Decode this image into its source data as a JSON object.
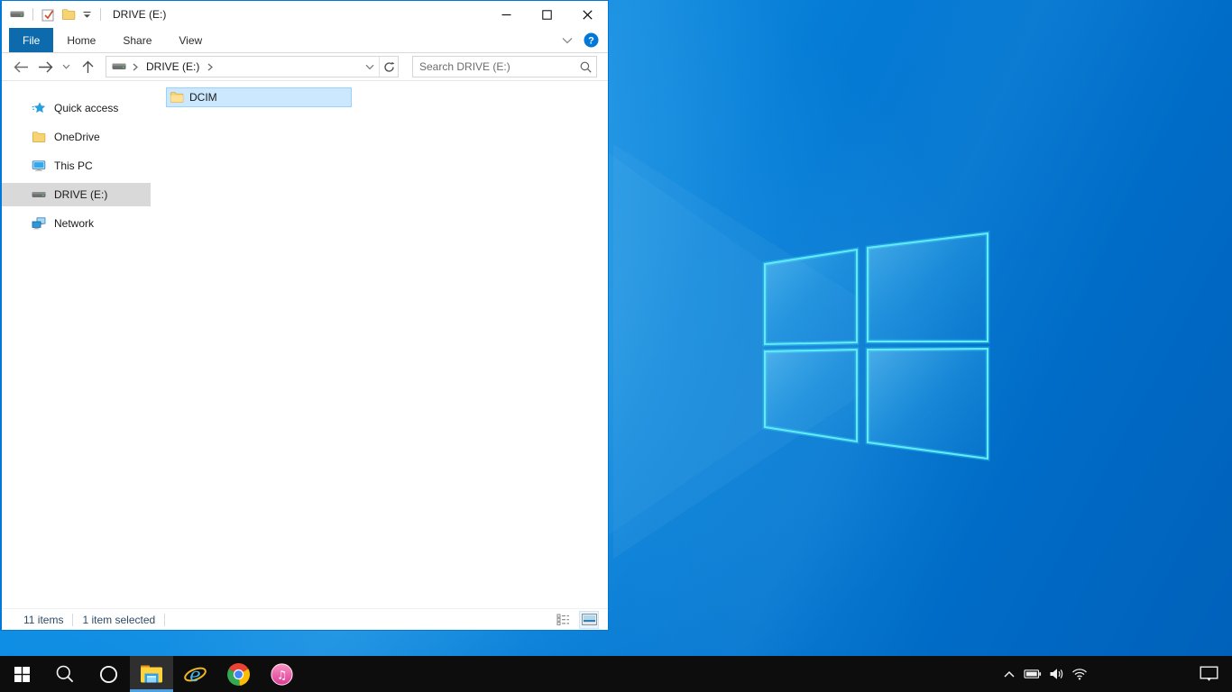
{
  "colors": {
    "accent": "#0078d7",
    "file_tab_bg": "#0d6aad",
    "selection_bg": "#cce8ff",
    "selection_border": "#99d1ff",
    "sidebar_selected_bg": "#d9d9d9",
    "status_text": "#2e4a66",
    "taskbar_bg": "#0d0d0d",
    "taskbar_active_underline": "#4a9fe3",
    "wallpaper_base": "#0a86de",
    "wallpaper_logo_stroke": "#58eef8",
    "folder_yellow": "#ffd269",
    "help_icon_bg": "#0078d7"
  },
  "window": {
    "title": "DRIVE (E:)",
    "quick_access_toolbar": {
      "icons": [
        "drive-icon",
        "properties-checkbox-icon",
        "new-folder-icon",
        "customize-chevron-icon"
      ]
    },
    "window_controls": [
      "minimize",
      "maximize",
      "close"
    ],
    "ribbon": {
      "tabs": [
        {
          "label": "File",
          "active": true
        },
        {
          "label": "Home",
          "active": false
        },
        {
          "label": "Share",
          "active": false
        },
        {
          "label": "View",
          "active": false
        }
      ],
      "expand_icon": "chevron-down-icon",
      "help_glyph": "?"
    },
    "navigation": {
      "root_icon": "drive-icon",
      "breadcrumb": [
        {
          "label": "DRIVE (E:)"
        }
      ],
      "search_placeholder": "Search DRIVE (E:)"
    },
    "sidebar": {
      "items": [
        {
          "label": "Quick access",
          "icon": "quick-access-star-icon",
          "selected": false
        },
        {
          "label": "OneDrive",
          "icon": "folder-icon",
          "selected": false
        },
        {
          "label": "This PC",
          "icon": "this-pc-monitor-icon",
          "selected": false
        },
        {
          "label": "DRIVE (E:)",
          "icon": "drive-icon",
          "selected": true
        },
        {
          "label": "Network",
          "icon": "network-icon",
          "selected": false
        }
      ]
    },
    "content": {
      "items": [
        {
          "label": "DCIM",
          "icon": "folder-icon",
          "selected": true
        }
      ]
    },
    "status_bar": {
      "item_count": "11 items",
      "selection_status": "1 item selected",
      "views": [
        "details-view-icon",
        "thumbnail-view-icon"
      ],
      "active_view": "thumbnail"
    }
  },
  "taskbar": {
    "buttons": [
      {
        "name": "start",
        "icon": "windows-logo-icon",
        "active": false
      },
      {
        "name": "search",
        "icon": "search-icon",
        "active": false
      },
      {
        "name": "cortana",
        "icon": "cortana-circle-icon",
        "active": false
      },
      {
        "name": "file-explorer",
        "icon": "file-explorer-folder-icon",
        "active": true
      },
      {
        "name": "internet-explorer",
        "icon": "internet-explorer-icon",
        "active": false
      },
      {
        "name": "chrome",
        "icon": "chrome-icon",
        "active": false
      },
      {
        "name": "itunes",
        "icon": "itunes-icon",
        "active": false
      }
    ],
    "ie_glyph": "e",
    "itunes_glyph": "♫",
    "tray_icons": [
      "chevron-up-icon",
      "battery-icon",
      "volume-icon",
      "wifi-icon"
    ],
    "action_center_icon": "action-center-icon"
  }
}
